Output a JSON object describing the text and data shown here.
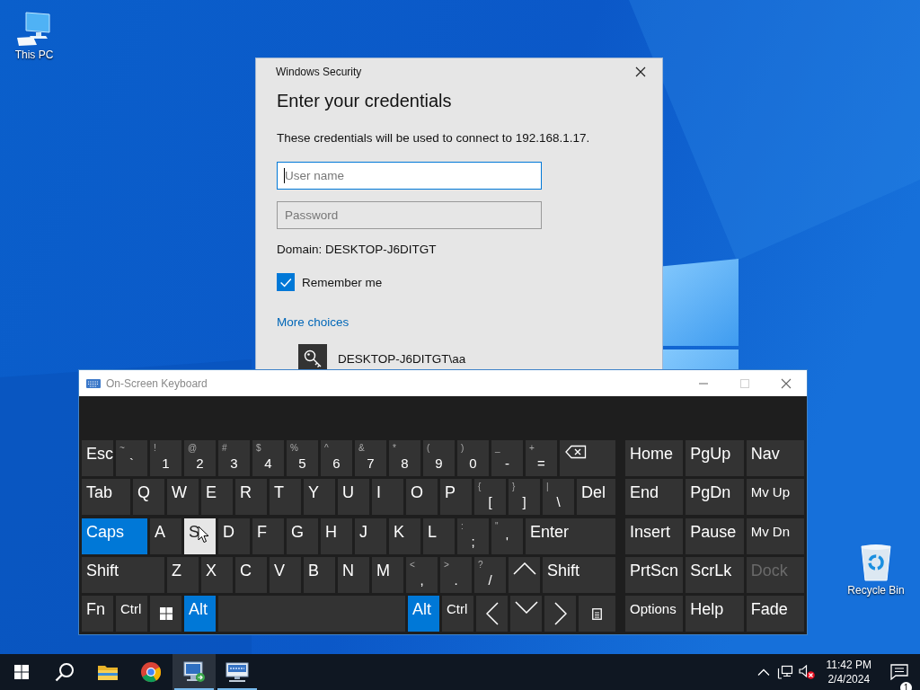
{
  "desktop_icons": [
    {
      "label": "This PC",
      "kind": "computer"
    },
    {
      "label": "Recycle Bin",
      "kind": "recycle-bin"
    }
  ],
  "dialog": {
    "title": "Windows Security",
    "heading": "Enter your credentials",
    "message": "These credentials will be used to connect to 192.168.1.17.",
    "username": {
      "placeholder": "User name",
      "focused": true
    },
    "password": {
      "placeholder": "Password",
      "focused": false
    },
    "domain": "Domain: DESKTOP-J6DITGT",
    "remember": {
      "label": "Remember me",
      "checked": true
    },
    "more_choices": "More choices",
    "account": "DESKTOP-J6DITGT\\aa"
  },
  "keyboard": {
    "title": "On-Screen Keyboard",
    "main_rows": [
      [
        {
          "label": "Esc",
          "kind": "esc",
          "pressed": false,
          "highlighted": false
        },
        {
          "label": "`",
          "shift": "~",
          "kind": "dual",
          "pressed": false,
          "highlighted": false
        },
        {
          "label": "1",
          "shift": "!",
          "kind": "dual",
          "pressed": false,
          "highlighted": false
        },
        {
          "label": "2",
          "shift": "@",
          "kind": "dual",
          "pressed": false,
          "highlighted": false
        },
        {
          "label": "3",
          "shift": "#",
          "kind": "dual",
          "pressed": false,
          "highlighted": false
        },
        {
          "label": "4",
          "shift": "$",
          "kind": "dual",
          "pressed": false,
          "highlighted": false
        },
        {
          "label": "5",
          "shift": "%",
          "kind": "dual",
          "pressed": false,
          "highlighted": false
        },
        {
          "label": "6",
          "shift": "^",
          "kind": "dual",
          "pressed": false,
          "highlighted": false
        },
        {
          "label": "7",
          "shift": "&",
          "kind": "dual",
          "pressed": false,
          "highlighted": false
        },
        {
          "label": "8",
          "shift": "*",
          "kind": "dual",
          "pressed": false,
          "highlighted": false
        },
        {
          "label": "9",
          "shift": "(",
          "kind": "dual",
          "pressed": false,
          "highlighted": false
        },
        {
          "label": "0",
          "shift": ")",
          "kind": "dual",
          "pressed": false,
          "highlighted": false
        },
        {
          "label": "-",
          "shift": "_",
          "kind": "dual",
          "pressed": false,
          "highlighted": false
        },
        {
          "label": "=",
          "shift": "+",
          "kind": "dual",
          "pressed": false,
          "highlighted": false
        },
        {
          "kind": "backspace",
          "pressed": false,
          "highlighted": false
        }
      ],
      [
        {
          "label": "Tab",
          "kind": "tab",
          "pressed": false,
          "highlighted": false
        },
        {
          "label": "Q",
          "kind": "letter",
          "pressed": false,
          "highlighted": false
        },
        {
          "label": "W",
          "kind": "letter",
          "pressed": false,
          "highlighted": false
        },
        {
          "label": "E",
          "kind": "letter",
          "pressed": false,
          "highlighted": false
        },
        {
          "label": "R",
          "kind": "letter",
          "pressed": false,
          "highlighted": false
        },
        {
          "label": "T",
          "kind": "letter",
          "pressed": false,
          "highlighted": false
        },
        {
          "label": "Y",
          "kind": "letter",
          "pressed": false,
          "highlighted": false
        },
        {
          "label": "U",
          "kind": "letter",
          "pressed": false,
          "highlighted": false
        },
        {
          "label": "I",
          "kind": "letter",
          "pressed": false,
          "highlighted": false
        },
        {
          "label": "O",
          "kind": "letter",
          "pressed": false,
          "highlighted": false
        },
        {
          "label": "P",
          "kind": "letter",
          "pressed": false,
          "highlighted": false
        },
        {
          "label": "[",
          "shift": "{",
          "kind": "dual",
          "pressed": false,
          "highlighted": false
        },
        {
          "label": "]",
          "shift": "}",
          "kind": "dual",
          "pressed": false,
          "highlighted": false
        },
        {
          "label": "\\",
          "shift": "|",
          "kind": "dual",
          "pressed": false,
          "highlighted": false
        },
        {
          "label": "Del",
          "kind": "del",
          "pressed": false,
          "highlighted": false
        }
      ],
      [
        {
          "label": "Caps",
          "kind": "caps",
          "pressed": true,
          "highlighted": false
        },
        {
          "label": "A",
          "kind": "letter",
          "pressed": false,
          "highlighted": false
        },
        {
          "label": "S",
          "kind": "letter",
          "pressed": false,
          "highlighted": true
        },
        {
          "label": "D",
          "kind": "letter",
          "pressed": false,
          "highlighted": false
        },
        {
          "label": "F",
          "kind": "letter",
          "pressed": false,
          "highlighted": false
        },
        {
          "label": "G",
          "kind": "letter",
          "pressed": false,
          "highlighted": false
        },
        {
          "label": "H",
          "kind": "letter",
          "pressed": false,
          "highlighted": false
        },
        {
          "label": "J",
          "kind": "letter",
          "pressed": false,
          "highlighted": false
        },
        {
          "label": "K",
          "kind": "letter",
          "pressed": false,
          "highlighted": false
        },
        {
          "label": "L",
          "kind": "letter",
          "pressed": false,
          "highlighted": false
        },
        {
          "label": ";",
          "shift": ":",
          "kind": "dual",
          "pressed": false,
          "highlighted": false
        },
        {
          "label": "'",
          "shift": "\"",
          "kind": "dual",
          "pressed": false,
          "highlighted": false
        },
        {
          "label": "Enter",
          "kind": "enter",
          "pressed": false,
          "highlighted": false
        }
      ],
      [
        {
          "label": "Shift",
          "kind": "lshift",
          "pressed": false,
          "highlighted": false
        },
        {
          "label": "Z",
          "kind": "letter",
          "pressed": false,
          "highlighted": false
        },
        {
          "label": "X",
          "kind": "letter",
          "pressed": false,
          "highlighted": false
        },
        {
          "label": "C",
          "kind": "letter",
          "pressed": false,
          "highlighted": false
        },
        {
          "label": "V",
          "kind": "letter",
          "pressed": false,
          "highlighted": false
        },
        {
          "label": "B",
          "kind": "letter",
          "pressed": false,
          "highlighted": false
        },
        {
          "label": "N",
          "kind": "letter",
          "pressed": false,
          "highlighted": false
        },
        {
          "label": "M",
          "kind": "letter",
          "pressed": false,
          "highlighted": false
        },
        {
          "label": ",",
          "shift": "<",
          "kind": "dual",
          "pressed": false,
          "highlighted": false
        },
        {
          "label": ".",
          "shift": ">",
          "kind": "dual",
          "pressed": false,
          "highlighted": false
        },
        {
          "label": "/",
          "shift": "?",
          "kind": "dual",
          "pressed": false,
          "highlighted": false
        },
        {
          "kind": "arrow-up",
          "pressed": false,
          "highlighted": false
        },
        {
          "label": "Shift",
          "kind": "rshift",
          "pressed": false,
          "highlighted": false
        }
      ],
      [
        {
          "label": "Fn",
          "kind": "fn",
          "pressed": false,
          "highlighted": false
        },
        {
          "label": "Ctrl",
          "kind": "ctrl",
          "pressed": false,
          "highlighted": false
        },
        {
          "kind": "win",
          "pressed": false,
          "highlighted": false
        },
        {
          "label": "Alt",
          "kind": "alt",
          "pressed": true,
          "highlighted": false
        },
        {
          "kind": "space",
          "pressed": false,
          "highlighted": false
        },
        {
          "label": "Alt",
          "kind": "alt",
          "pressed": true,
          "highlighted": false
        },
        {
          "label": "Ctrl",
          "kind": "ctrl",
          "pressed": false,
          "highlighted": false
        },
        {
          "kind": "arrow-left",
          "pressed": false,
          "highlighted": false
        },
        {
          "kind": "arrow-down",
          "pressed": false,
          "highlighted": false
        },
        {
          "kind": "arrow-right",
          "pressed": false,
          "highlighted": false
        },
        {
          "kind": "menu",
          "pressed": false,
          "highlighted": false
        }
      ]
    ],
    "side_rows": [
      [
        {
          "label": "Home",
          "kind": "nav",
          "disabled": false
        },
        {
          "label": "PgUp",
          "kind": "nav",
          "disabled": false
        },
        {
          "label": "Nav",
          "kind": "nav",
          "disabled": false
        }
      ],
      [
        {
          "label": "End",
          "kind": "nav",
          "disabled": false
        },
        {
          "label": "PgDn",
          "kind": "nav",
          "disabled": false
        },
        {
          "label": "Mv Up",
          "kind": "nav-small",
          "disabled": false
        }
      ],
      [
        {
          "label": "Insert",
          "kind": "nav",
          "disabled": false
        },
        {
          "label": "Pause",
          "kind": "nav",
          "disabled": false
        },
        {
          "label": "Mv Dn",
          "kind": "nav-small",
          "disabled": false
        }
      ],
      [
        {
          "label": "PrtScn",
          "kind": "nav",
          "disabled": false
        },
        {
          "label": "ScrLk",
          "kind": "nav",
          "disabled": false
        },
        {
          "label": "Dock",
          "kind": "nav",
          "disabled": true
        }
      ],
      [
        {
          "label": "Options",
          "kind": "nav-small",
          "disabled": false
        },
        {
          "label": "Help",
          "kind": "nav",
          "disabled": false
        },
        {
          "label": "Fade",
          "kind": "nav",
          "disabled": false
        }
      ]
    ]
  },
  "taskbar": {
    "apps": [
      {
        "kind": "start",
        "running": false,
        "selected": false
      },
      {
        "kind": "search",
        "running": false,
        "selected": false
      },
      {
        "kind": "folder",
        "running": false,
        "selected": false
      },
      {
        "kind": "browser",
        "running": false,
        "selected": false
      },
      {
        "kind": "remote-desktop",
        "running": true,
        "selected": true
      },
      {
        "kind": "network-computer",
        "running": true,
        "selected": false
      }
    ],
    "tray": [
      {
        "kind": "chevron"
      },
      {
        "kind": "network"
      },
      {
        "kind": "volume-muted"
      }
    ],
    "clock": {
      "time": "11:42 PM",
      "date": "2/4/2024"
    },
    "notifications": {
      "count": "1"
    }
  }
}
